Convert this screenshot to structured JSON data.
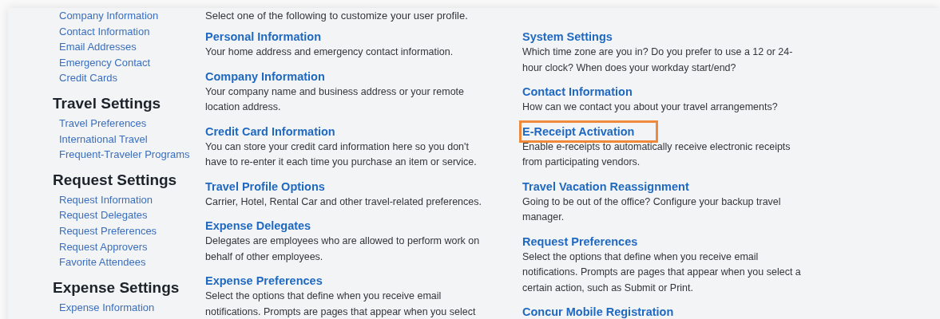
{
  "sidebar": {
    "groups": [
      {
        "items": [
          "Company Information",
          "Contact Information",
          "Email Addresses",
          "Emergency Contact",
          "Credit Cards"
        ]
      },
      {
        "heading": "Travel Settings",
        "items": [
          "Travel Preferences",
          "International Travel",
          "Frequent-Traveler Programs"
        ]
      },
      {
        "heading": "Request Settings",
        "items": [
          "Request Information",
          "Request Delegates",
          "Request Preferences",
          "Request Approvers",
          "Favorite Attendees"
        ]
      },
      {
        "heading": "Expense Settings",
        "items": [
          "Expense Information"
        ]
      }
    ]
  },
  "intro": "Select one of the following to customize your user profile.",
  "columns": [
    {
      "items": [
        {
          "title": "Personal Information",
          "description": "Your home address and emergency contact information.",
          "highlighted": false
        },
        {
          "title": "Company Information",
          "description": "Your company name and business address or your remote location address.",
          "highlighted": false
        },
        {
          "title": "Credit Card Information",
          "description": "You can store your credit card information here so you don't have to re-enter it each time you purchase an item or service.",
          "highlighted": false
        },
        {
          "title": "Travel Profile Options",
          "description": "Carrier, Hotel, Rental Car and other travel-related preferences.",
          "highlighted": false
        },
        {
          "title": "Expense Delegates",
          "description": "Delegates are employees who are allowed to perform work on behalf of other employees.",
          "highlighted": false
        },
        {
          "title": "Expense Preferences",
          "description": "Select the options that define when you receive email notifications. Prompts are pages that appear when you select",
          "highlighted": false
        }
      ]
    },
    {
      "items": [
        {
          "title": "System Settings",
          "description": "Which time zone are you in? Do you prefer to use a 12 or 24-hour clock? When does your workday start/end?",
          "highlighted": false
        },
        {
          "title": "Contact Information",
          "description": "How can we contact you about your travel arrangements?",
          "highlighted": false
        },
        {
          "title": "E-Receipt Activation",
          "description": "Enable e-receipts to automatically receive electronic receipts from participating vendors.",
          "highlighted": true
        },
        {
          "title": "Travel Vacation Reassignment",
          "description": "Going to be out of the office? Configure your backup travel manager.",
          "highlighted": false
        },
        {
          "title": "Request Preferences",
          "description": "Select the options that define when you receive email notifications. Prompts are pages that appear when you select a certain action, such as Submit or Print.",
          "highlighted": false
        },
        {
          "title": "Concur Mobile Registration",
          "highlighted": false
        }
      ]
    }
  ]
}
